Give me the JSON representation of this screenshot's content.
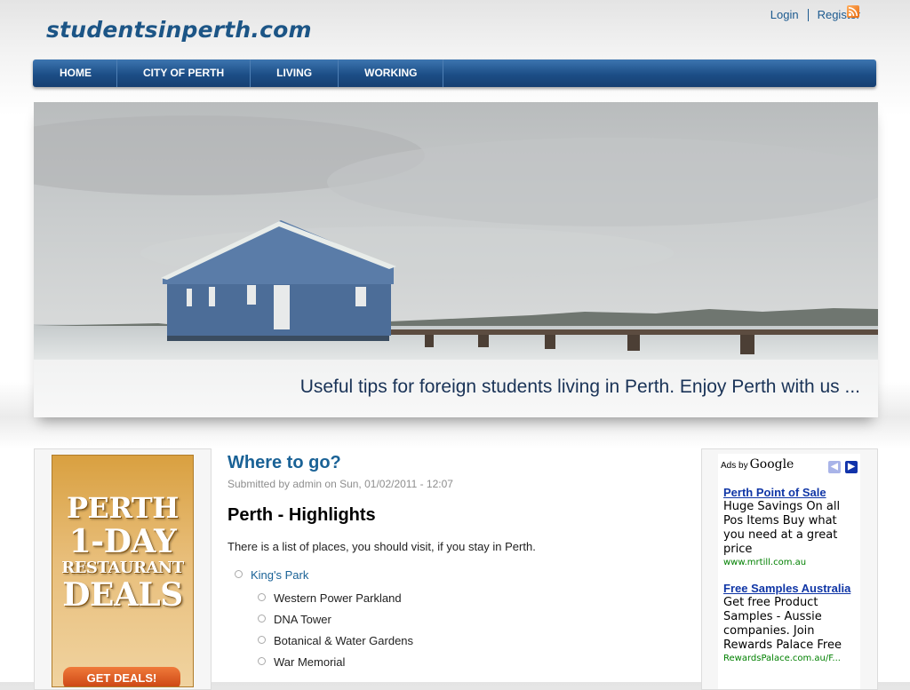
{
  "site": {
    "name": "studentsinperth.com"
  },
  "topnav": {
    "login": "Login",
    "register": "Register",
    "rss_icon": "rss-icon"
  },
  "menu": [
    {
      "label": "HOME"
    },
    {
      "label": "CITY OF PERTH"
    },
    {
      "label": "LIVING"
    },
    {
      "label": "WORKING"
    }
  ],
  "banner": {
    "tagline": "Useful tips for foreign students living in Perth. Enjoy Perth with us ..."
  },
  "left_ad": {
    "lines": [
      "PERTH",
      "1-DAY",
      "RESTAURANT",
      "DEALS"
    ],
    "cta": "GET DEALS!"
  },
  "content": {
    "title": "Where to go?",
    "submitted": "Submitted by admin on Sun, 01/02/2011 - 12:07",
    "heading": "Perth - Highlights",
    "intro": "There is a list of places, you should visit, if you stay in Perth.",
    "places": [
      {
        "name": "King's Park",
        "children": [
          "Western Power Parkland",
          "DNA Tower",
          "Botanical & Water Gardens",
          "War Memorial"
        ]
      }
    ]
  },
  "ads": {
    "ads_by": "Ads by",
    "google": "Google",
    "items": [
      {
        "title": "Perth Point of Sale",
        "desc": "Huge Savings On all Pos Items Buy what you need at a great price",
        "url": "www.mrtill.com.au"
      },
      {
        "title": "Free Samples Australia",
        "desc": "Get free Product Samples - Aussie companies. Join Rewards Palace Free",
        "url": "RewardsPalace.com.au/F..."
      }
    ]
  },
  "colors": {
    "brand": "#1c5586",
    "menu_bg": "#1c4e86",
    "link": "#1a6296",
    "ad_title": "#1036a6",
    "ad_url": "#008000"
  }
}
